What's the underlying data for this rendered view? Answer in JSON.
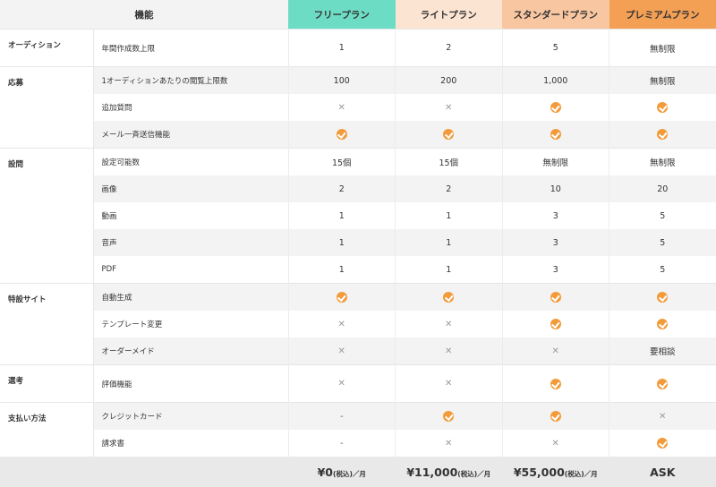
{
  "header": {
    "feature": "機能",
    "plans": [
      "フリープラン",
      "ライトプラン",
      "スタンダードプラン",
      "プレミアムプラン"
    ]
  },
  "rows": [
    {
      "category": "オーディション",
      "feature": "年間作成数上限",
      "values": [
        "1",
        "2",
        "5",
        "無制限"
      ]
    },
    {
      "category": "応募",
      "feature": "1オーディションあたりの閲覧上限数",
      "values": [
        "100",
        "200",
        "1,000",
        "無制限"
      ]
    },
    {
      "category": "",
      "feature": "追加質問",
      "values": [
        "x",
        "x",
        "check",
        "check"
      ]
    },
    {
      "category": "",
      "feature": "メール一斉送信機能",
      "values": [
        "check",
        "check",
        "check",
        "check"
      ]
    },
    {
      "category": "設問",
      "feature": "設定可能数",
      "values": [
        "15個",
        "15個",
        "無制限",
        "無制限"
      ]
    },
    {
      "category": "",
      "feature": "画像",
      "values": [
        "2",
        "2",
        "10",
        "20"
      ]
    },
    {
      "category": "",
      "feature": "動画",
      "values": [
        "1",
        "1",
        "3",
        "5"
      ]
    },
    {
      "category": "",
      "feature": "音声",
      "values": [
        "1",
        "1",
        "3",
        "5"
      ]
    },
    {
      "category": "",
      "feature": "PDF",
      "values": [
        "1",
        "1",
        "3",
        "5"
      ]
    },
    {
      "category": "特設サイト",
      "feature": "自動生成",
      "values": [
        "check",
        "check",
        "check",
        "check"
      ]
    },
    {
      "category": "",
      "feature": "テンプレート変更",
      "values": [
        "x",
        "x",
        "check",
        "check"
      ]
    },
    {
      "category": "",
      "feature": "オーダーメイド",
      "values": [
        "x",
        "x",
        "x",
        "要相談"
      ]
    },
    {
      "category": "選考",
      "feature": "評価機能",
      "values": [
        "x",
        "x",
        "check",
        "check"
      ]
    },
    {
      "category": "支払い方法",
      "feature": "クレジットカード",
      "values": [
        "-",
        "check",
        "check",
        "x"
      ]
    },
    {
      "category": "",
      "feature": "請求書",
      "values": [
        "-",
        "x",
        "x",
        "check"
      ]
    }
  ],
  "prices": [
    {
      "amount": "¥0",
      "suffix": "(税込)／月"
    },
    {
      "amount": "¥11,000",
      "suffix": "(税込)／月"
    },
    {
      "amount": "¥55,000",
      "suffix": "(税込)／月"
    },
    {
      "amount": "ASK",
      "suffix": ""
    }
  ],
  "symbols": {
    "x": "✕",
    "dash": "-"
  },
  "colors": {
    "free": "#6ddcc4",
    "lite": "#fce4d2",
    "standard": "#f8c6a0",
    "premium": "#f3a055",
    "check": "#f29b3b"
  }
}
